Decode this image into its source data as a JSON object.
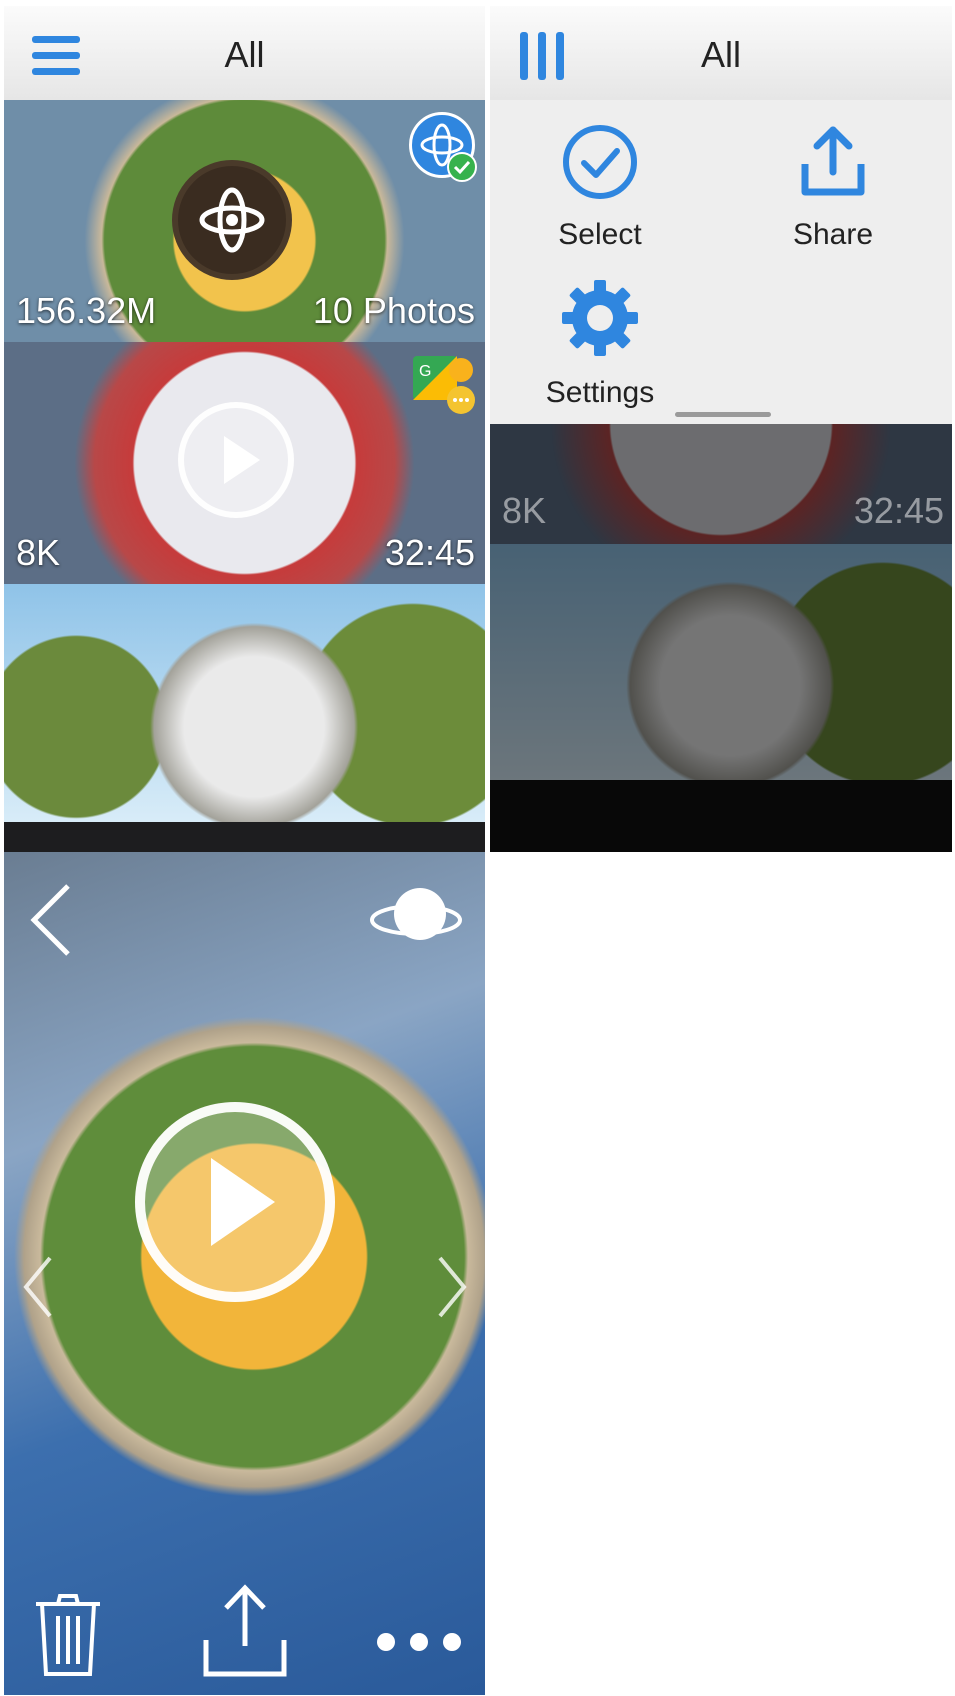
{
  "gallery": {
    "title": "All",
    "tiles": [
      {
        "left_text": "156.32M",
        "right_text": "10 Photos"
      },
      {
        "left_text": "8K",
        "right_text": "32:45"
      }
    ]
  },
  "menu_screen": {
    "title": "All",
    "menu": {
      "select_label": "Select",
      "share_label": "Share",
      "settings_label": "Settings"
    },
    "tiles": [
      {
        "left_text": "8K",
        "right_text": "32:45"
      }
    ]
  },
  "viewer": {
    "icons": [
      "back-icon",
      "planet-view-icon",
      "play-icon",
      "prev-icon",
      "next-icon",
      "trash-icon",
      "share-icon",
      "more-icon"
    ]
  },
  "colors": {
    "accent": "#2f86df",
    "badge_green": "#37b24d"
  }
}
